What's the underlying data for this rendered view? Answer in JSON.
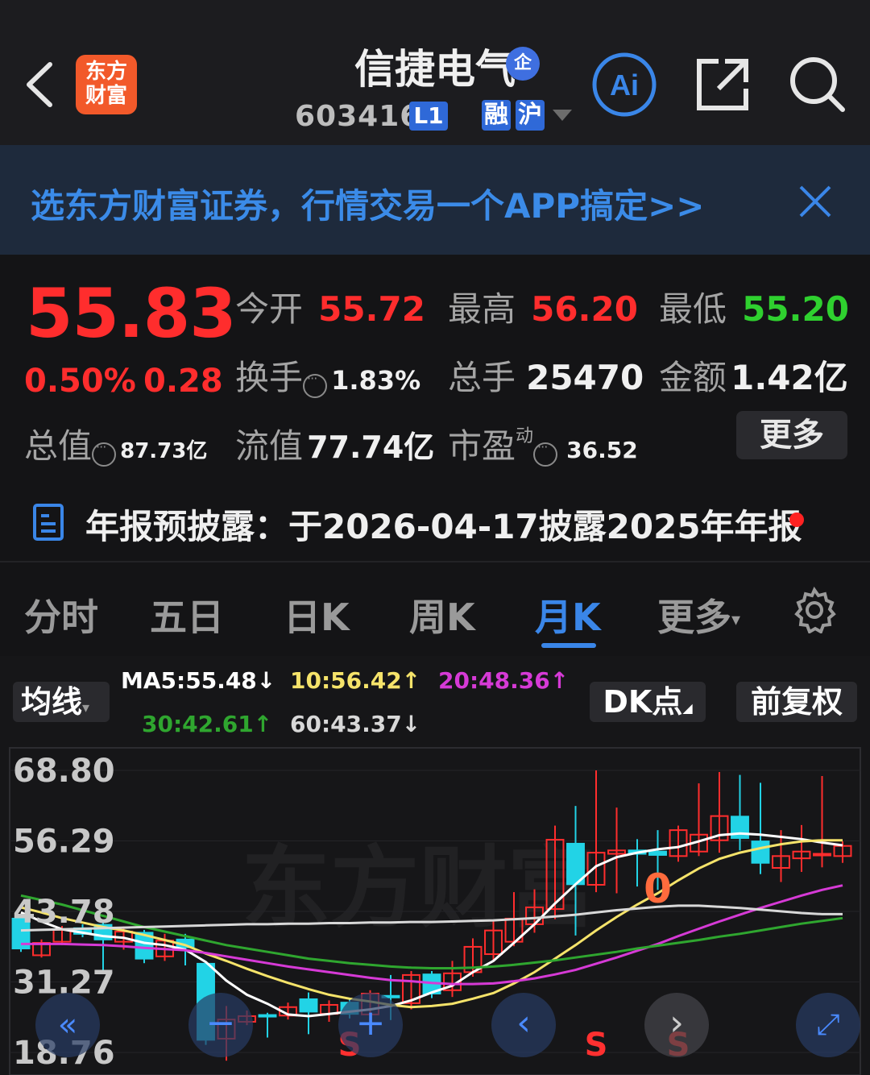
{
  "header": {
    "title": "信捷电气",
    "title_badge": "企",
    "code": "603416",
    "level_badge": "L1",
    "tag_rong": "融",
    "tag_hu": "沪",
    "logo_text_line1": "东方",
    "logo_text_line2": "财富",
    "ai_label": "Ai"
  },
  "banner": {
    "text": "选东方财富证券，行情交易一个APP搞定>>"
  },
  "quote": {
    "price": "55.83",
    "change_pct": "0.50%",
    "change_val": "0.28",
    "open_label": "今开",
    "open": "55.72",
    "high_label": "最高",
    "high": "56.20",
    "low_label": "最低",
    "low": "55.20",
    "turnover_label": "换手",
    "turnover": "1.83%",
    "volume_label": "总手",
    "volume": "25470",
    "amount_label": "金额",
    "amount": "1.42亿",
    "mktcap_label": "总值",
    "mktcap": "87.73亿",
    "float_label": "流值",
    "float_cap": "77.74亿",
    "pe_label": "市盈",
    "pe_sup": "动",
    "pe": "36.52",
    "more_label": "更多"
  },
  "notice": {
    "text": "年报预披露：于2026-04-17披露2025年年报"
  },
  "tabs": [
    {
      "label": "分时"
    },
    {
      "label": "五日"
    },
    {
      "label": "日K"
    },
    {
      "label": "周K"
    },
    {
      "label": "月K"
    },
    {
      "label": "更多"
    }
  ],
  "chart_controls": {
    "avg_label": "均线",
    "ma5": "MA5:55.48↓",
    "ma10": "10:56.42↑",
    "ma20": "20:48.36↑",
    "ma30": "30:42.61↑",
    "ma60": "60:43.37↓",
    "dk_label": "DK点",
    "fq_label": "前复权"
  },
  "colors": {
    "up": "#ff2d2d",
    "down": "#22d3e6",
    "accent": "#3a86e8",
    "ma5": "#ffffff",
    "ma10": "#f5e36a",
    "ma20": "#d63ad6",
    "ma30": "#2fa62f",
    "ma60": "#d8d8d8"
  },
  "chart_data": {
    "type": "candlestick",
    "y_ticks": [
      "68.80",
      "56.29",
      "43.78",
      "31.27",
      "18.76"
    ],
    "ylim": [
      18.76,
      68.8
    ],
    "watermark": "东方财富",
    "candles": [
      {
        "o": 42.5,
        "c": 37.2,
        "h": 43.0,
        "l": 36.6
      },
      {
        "o": 36.0,
        "c": 38.2,
        "h": 38.8,
        "l": 35.6
      },
      {
        "o": 38.4,
        "c": 40.5,
        "h": 41.2,
        "l": 37.8
      },
      {
        "o": 40.8,
        "c": 39.8,
        "h": 41.5,
        "l": 39.2
      },
      {
        "o": 41.4,
        "c": 38.8,
        "h": 42.3,
        "l": 33.4
      },
      {
        "o": 38.4,
        "c": 40.2,
        "h": 41.1,
        "l": 37.0
      },
      {
        "o": 40.0,
        "c": 35.4,
        "h": 40.5,
        "l": 34.6
      },
      {
        "o": 35.8,
        "c": 38.6,
        "h": 39.8,
        "l": 35.0
      },
      {
        "o": 38.8,
        "c": 37.4,
        "h": 39.8,
        "l": 34.2
      },
      {
        "o": 34.5,
        "c": 21.0,
        "h": 35.0,
        "l": 20.1
      },
      {
        "o": 21.2,
        "c": 24.6,
        "h": 27.0,
        "l": 17.3
      },
      {
        "o": 24.2,
        "c": 25.2,
        "h": 26.2,
        "l": 23.6
      },
      {
        "o": 25.4,
        "c": 25.2,
        "h": 25.8,
        "l": 21.4
      },
      {
        "o": 25.3,
        "c": 26.8,
        "h": 27.6,
        "l": 24.6
      },
      {
        "o": 28.2,
        "c": 26.0,
        "h": 29.4,
        "l": 22.0
      },
      {
        "o": 25.6,
        "c": 27.2,
        "h": 28.0,
        "l": 24.2
      },
      {
        "o": 27.6,
        "c": 25.6,
        "h": 28.2,
        "l": 24.8
      },
      {
        "o": 25.5,
        "c": 29.2,
        "h": 29.8,
        "l": 24.3
      },
      {
        "o": 28.8,
        "c": 28.6,
        "h": 32.5,
        "l": 24.5
      },
      {
        "o": 27.5,
        "c": 32.5,
        "h": 33.2,
        "l": 26.4
      },
      {
        "o": 32.6,
        "c": 29.2,
        "h": 33.2,
        "l": 28.4
      },
      {
        "o": 29.8,
        "c": 32.8,
        "h": 35.0,
        "l": 28.6
      },
      {
        "o": 33.0,
        "c": 37.5,
        "h": 39.0,
        "l": 32.2
      },
      {
        "o": 36.2,
        "c": 40.4,
        "h": 42.0,
        "l": 35.0
      },
      {
        "o": 38.4,
        "c": 42.5,
        "h": 47.2,
        "l": 37.6
      },
      {
        "o": 41.5,
        "c": 44.5,
        "h": 47.7,
        "l": 40.0
      },
      {
        "o": 44.2,
        "c": 56.5,
        "h": 59.0,
        "l": 42.4
      },
      {
        "o": 55.8,
        "c": 48.6,
        "h": 62.5,
        "l": 39.5
      },
      {
        "o": 48.5,
        "c": 54.2,
        "h": 68.8,
        "l": 47.2
      },
      {
        "o": 54.0,
        "c": 54.6,
        "h": 62.2,
        "l": 47.0
      },
      {
        "o": 54.6,
        "c": 54.0,
        "h": 56.6,
        "l": 48.2
      },
      {
        "o": 54.4,
        "c": 53.8,
        "h": 58.2,
        "l": 47.6
      },
      {
        "o": 53.6,
        "c": 58.2,
        "h": 59.0,
        "l": 52.6
      },
      {
        "o": 54.4,
        "c": 57.4,
        "h": 66.5,
        "l": 53.6
      },
      {
        "o": 56.4,
        "c": 60.7,
        "h": 68.5,
        "l": 54.2
      },
      {
        "o": 60.6,
        "c": 56.8,
        "h": 68.0,
        "l": 54.6
      },
      {
        "o": 56.2,
        "c": 52.4,
        "h": 66.6,
        "l": 50.4
      },
      {
        "o": 51.5,
        "c": 53.6,
        "h": 58.2,
        "l": 49.0
      },
      {
        "o": 53.2,
        "c": 54.4,
        "h": 59.1,
        "l": 50.8
      },
      {
        "o": 54.0,
        "c": 54.0,
        "h": 67.8,
        "l": 51.6
      },
      {
        "o": 53.6,
        "c": 55.4,
        "h": 56.2,
        "l": 52.4
      }
    ],
    "ma_series": [
      {
        "name": "MA5",
        "values": [
          43.6,
          42.0,
          40.6,
          40.0,
          39.4,
          39.1,
          38.2,
          37.8,
          37.0,
          34.8,
          31.5,
          29.0,
          27.4,
          25.5,
          25.2,
          25.6,
          26.0,
          26.4,
          27.0,
          28.0,
          29.4,
          30.6,
          33.0,
          35.0,
          38.2,
          41.5,
          45.2,
          48.6,
          51.8,
          53.4,
          54.2,
          54.8,
          55.2,
          56.2,
          57.3,
          57.6,
          57.4,
          57.0,
          56.6,
          56.0,
          55.5
        ]
      },
      {
        "name": "MA10",
        "values": [
          44.5,
          43.6,
          42.6,
          41.8,
          41.0,
          40.4,
          39.6,
          38.7,
          37.8,
          36.3,
          35.0,
          33.6,
          32.3,
          31.1,
          30.0,
          29.0,
          28.3,
          27.8,
          27.2,
          26.8,
          27.0,
          27.4,
          28.3,
          29.3,
          31.0,
          33.0,
          35.4,
          37.8,
          40.4,
          42.8,
          45.0,
          47.0,
          49.3,
          51.4,
          53.1,
          54.2,
          55.0,
          55.7,
          56.2,
          56.4,
          56.4
        ]
      },
      {
        "name": "MA20",
        "values": [
          38.0,
          38.0,
          38.0,
          37.9,
          37.8,
          37.6,
          37.3,
          37.1,
          36.9,
          36.4,
          35.8,
          35.2,
          34.6,
          34.0,
          33.5,
          33.0,
          32.5,
          32.0,
          31.6,
          31.4,
          31.1,
          30.9,
          30.9,
          31.0,
          31.4,
          31.9,
          32.6,
          33.4,
          34.5,
          35.6,
          36.8,
          38.0,
          39.4,
          40.7,
          42.0,
          43.2,
          44.4,
          45.5,
          46.6,
          47.6,
          48.4
        ]
      },
      {
        "name": "MA30",
        "values": [
          46.6,
          45.8,
          45.0,
          44.0,
          43.0,
          42.0,
          41.0,
          40.2,
          39.4,
          38.6,
          37.8,
          37.2,
          36.6,
          36.0,
          35.4,
          35.0,
          34.6,
          34.3,
          34.0,
          33.8,
          33.7,
          33.7,
          33.8,
          34.0,
          34.3,
          34.7,
          35.1,
          35.6,
          36.1,
          36.6,
          37.2,
          37.7,
          38.2,
          38.7,
          39.3,
          39.8,
          40.4,
          41.0,
          41.6,
          42.1,
          42.6
        ]
      },
      {
        "name": "MA60",
        "values": [
          40.4,
          40.5,
          40.6,
          40.7,
          40.8,
          40.9,
          41.0,
          41.1,
          41.2,
          41.3,
          41.4,
          41.5,
          41.5,
          41.6,
          41.6,
          41.7,
          41.7,
          41.8,
          41.8,
          41.9,
          41.9,
          42.0,
          42.1,
          42.2,
          42.4,
          42.6,
          42.9,
          43.2,
          43.6,
          44.0,
          44.3,
          44.6,
          44.8,
          44.8,
          44.6,
          44.4,
          44.1,
          43.8,
          43.5,
          43.3,
          43.3
        ]
      }
    ],
    "markers": [
      {
        "label": "S",
        "index": 16
      },
      {
        "label": "S",
        "index": 28
      },
      {
        "label": "S",
        "index": 32
      },
      {
        "label": "0",
        "index": 31
      }
    ]
  }
}
